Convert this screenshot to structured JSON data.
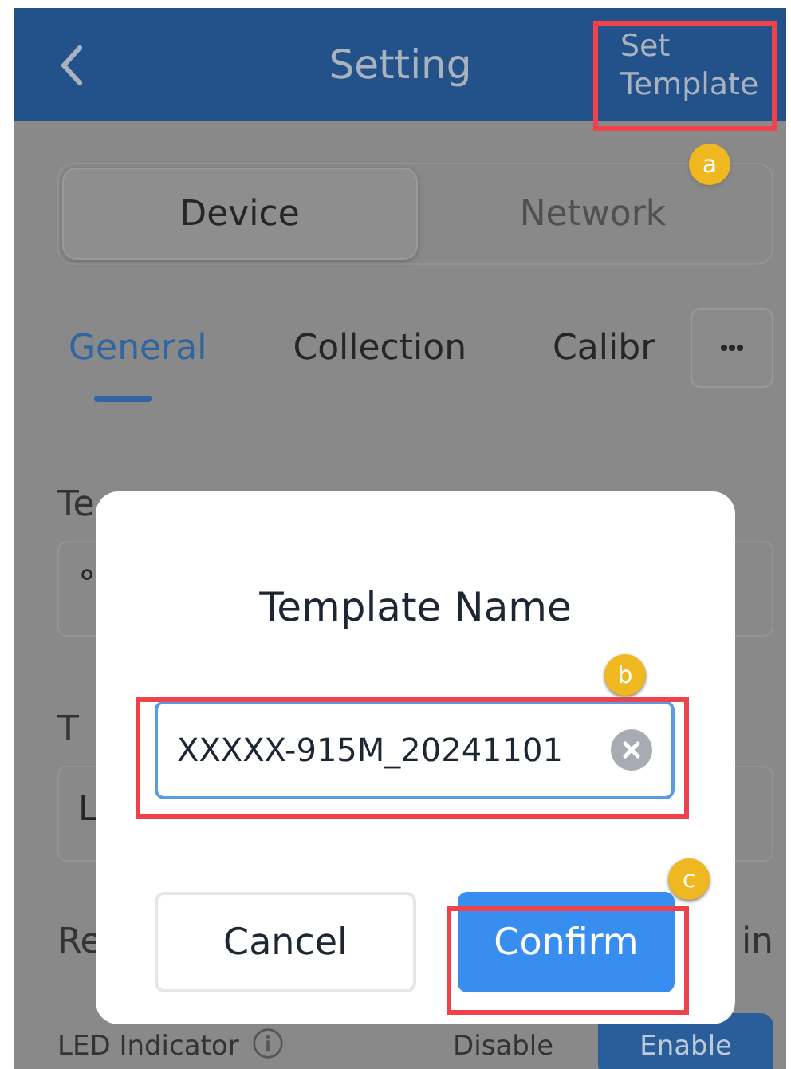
{
  "header": {
    "title": "Setting",
    "action": "Set Template"
  },
  "segments": [
    {
      "label": "Device",
      "selected": true
    },
    {
      "label": "Network",
      "selected": false
    }
  ],
  "tabs": [
    {
      "label": "General",
      "selected": true
    },
    {
      "label": "Collection",
      "selected": false
    },
    {
      "label": "Calibr",
      "selected": false
    }
  ],
  "settings": [
    {
      "kind": "field",
      "label": "Te",
      "value": "°"
    },
    {
      "kind": "field",
      "label": "T",
      "value": "L"
    },
    {
      "kind": "text",
      "label": "Re",
      "value": "in"
    },
    {
      "kind": "toggle",
      "label": "LED Indicator",
      "options": [
        {
          "label": "Disable",
          "selected": false
        },
        {
          "label": "Enable",
          "selected": true
        }
      ]
    }
  ],
  "dialog": {
    "title": "Template Name",
    "input": {
      "value": "XXXXX-915M_20241101"
    },
    "buttons": [
      {
        "label": "Cancel",
        "kind": "secondary"
      },
      {
        "label": "Confirm",
        "kind": "primary"
      }
    ]
  },
  "annotations": [
    {
      "label": "a"
    },
    {
      "label": "b"
    },
    {
      "label": "c"
    }
  ]
}
